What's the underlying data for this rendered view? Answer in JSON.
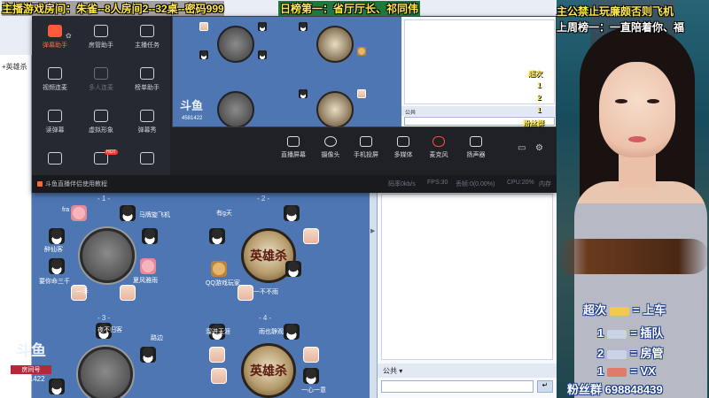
{
  "overlay": {
    "main_banner": "主播游戏房间：朱雀--8人房间2--32桌--密码999",
    "daily_banner": "日榜第一：省厅厅长、祁同伟",
    "cam_rule": "主公禁止玩廉颇否则飞机",
    "cam_weekly": "上周榜一：一直陪着你、福",
    "cam_side_labels": [
      "超次",
      "1",
      "2",
      "1",
      "粉丝群"
    ],
    "perks": [
      {
        "qty": "超次",
        "result": "= 上车"
      },
      {
        "qty": "1",
        "result": "= 插队"
      },
      {
        "qty": "2",
        "result": "= 房管"
      },
      {
        "qty": "1",
        "result": "= VX"
      }
    ],
    "fans_group": "粉丝群 698848439"
  },
  "lobby": {
    "tree_item": "+英雄杀",
    "douyu_logo": "斗鱼",
    "room_badge": "房间号",
    "room_number": "4581422",
    "chat_channel": "公共",
    "tables": [
      {
        "no": "- 1 -",
        "players": [
          "fra",
          "马牌旋飞机",
          "醉仙客",
          "夏风雅雨",
          "要你命三千",
          "一手"
        ]
      },
      {
        "no": "- 2 -",
        "players": [
          "有g天",
          "QQ游戏玩家",
          "一不不雨"
        ]
      },
      {
        "no": "- 3 -",
        "players": [
          "夜不归客",
          "路边"
        ]
      },
      {
        "no": "- 4 -",
        "players": [
          "溜进天涯",
          "雨也静观",
          "一心一意"
        ]
      }
    ],
    "table_logo_text": "英雄杀"
  },
  "assistant": {
    "tools": [
      {
        "label": "弹幕助手",
        "active": true,
        "disabled": false,
        "hot": false
      },
      {
        "label": "房管助手",
        "active": false,
        "disabled": false,
        "hot": false
      },
      {
        "label": "主播任务",
        "active": false,
        "disabled": false,
        "hot": false
      },
      {
        "label": "视频连麦",
        "active": false,
        "disabled": false,
        "hot": false
      },
      {
        "label": "多人连麦",
        "active": false,
        "disabled": true,
        "hot": false
      },
      {
        "label": "榜单助手",
        "active": false,
        "disabled": false,
        "hot": false
      },
      {
        "label": "读弹幕",
        "active": false,
        "disabled": false,
        "hot": false
      },
      {
        "label": "虚拟形象",
        "active": false,
        "disabled": false,
        "hot": false
      },
      {
        "label": "弹幕秀",
        "active": false,
        "disabled": false,
        "hot": false
      },
      {
        "label": "",
        "active": false,
        "disabled": false,
        "hot": false
      },
      {
        "label": "",
        "active": false,
        "disabled": false,
        "hot": true
      },
      {
        "label": "",
        "active": false,
        "disabled": false,
        "hot": false
      }
    ],
    "hot_badge": "HOT",
    "controls": [
      "直播屏幕",
      "摄像头",
      "手机投屏",
      "多媒体",
      "麦克风",
      "扬声器"
    ],
    "tip": "斗鱼直播伴侣使用教程",
    "stats": [
      "码率0kb/s",
      "FPS:30",
      "丢帧:0(0.00%)",
      "CPU:20%",
      "内存"
    ]
  },
  "colors": {
    "banner_yellow": "#ffe84a",
    "accent_orange": "#ff5a3c",
    "lobby_blue": "#4e76b3"
  }
}
